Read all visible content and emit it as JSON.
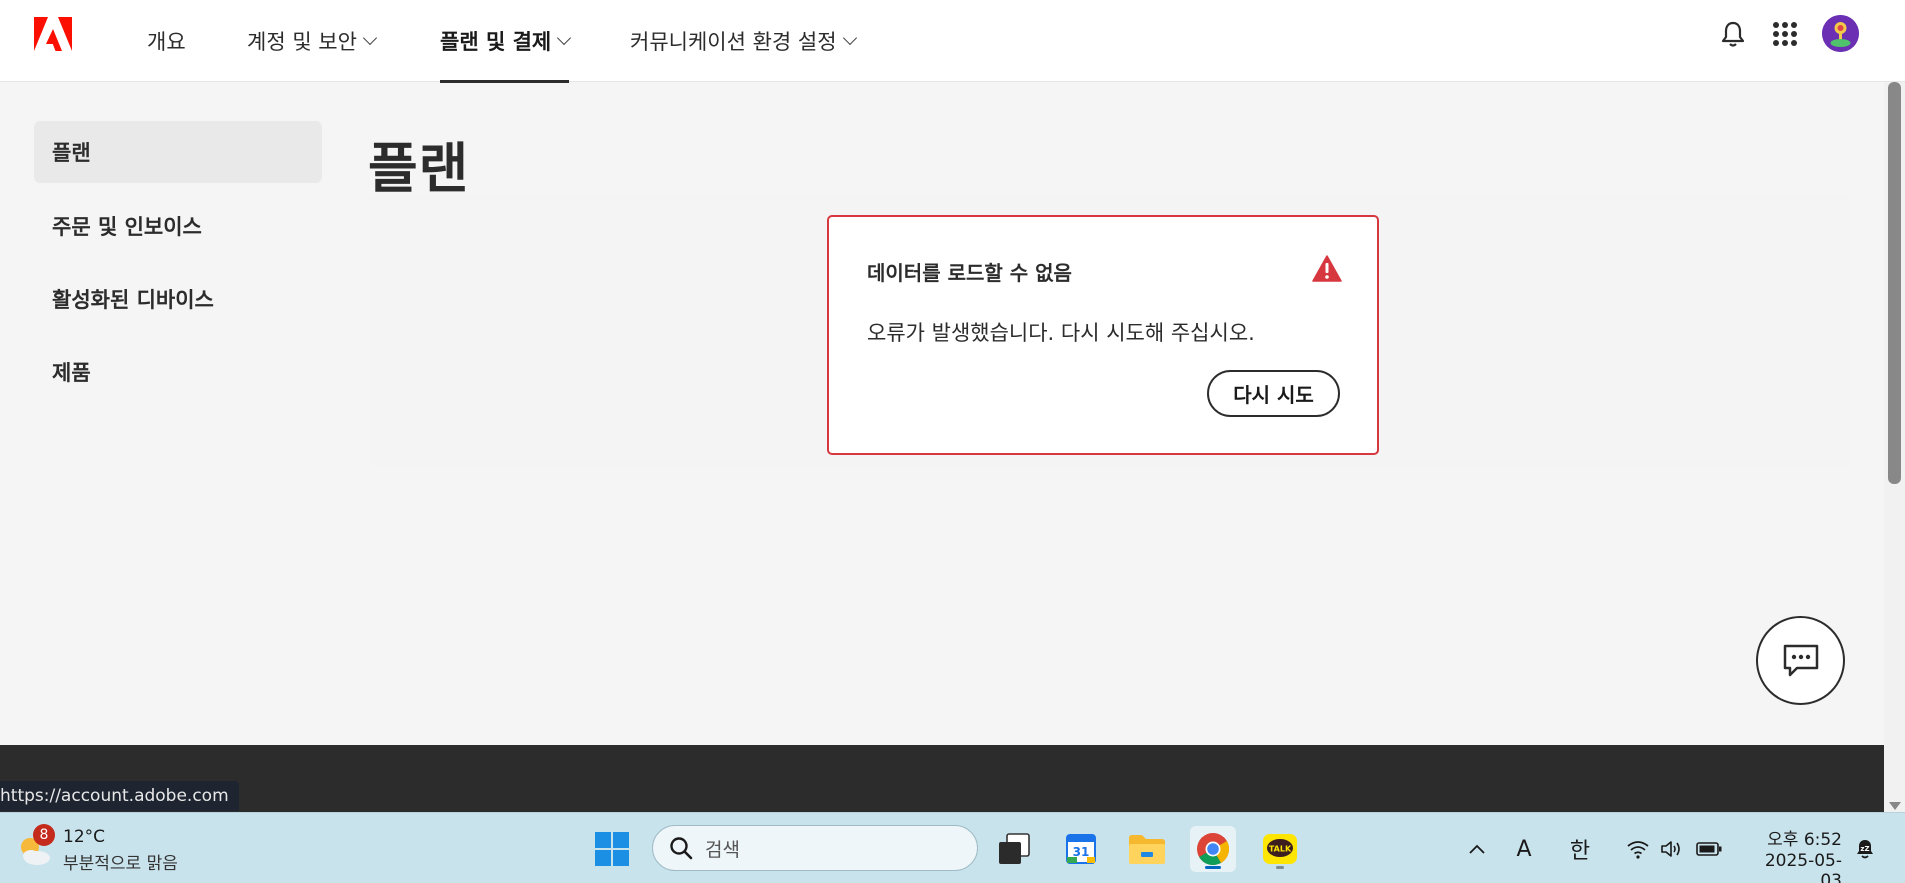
{
  "nav": {
    "items": [
      {
        "label": "개요"
      },
      {
        "label": "계정 및 보안"
      },
      {
        "label": "플랜 및 결제"
      },
      {
        "label": "커뮤니케이션 환경 설정"
      }
    ],
    "icons": [
      "adobe-logo-icon",
      "bell-icon",
      "apps-grid-icon",
      "avatar"
    ]
  },
  "sidebar": {
    "items": [
      {
        "label": "플랜"
      },
      {
        "label": "주문 및 인보이스"
      },
      {
        "label": "활성화된 디바이스"
      },
      {
        "label": "제품"
      }
    ]
  },
  "main": {
    "title": "플랜",
    "error": {
      "title": "데이터를 로드할 수 없음",
      "message": "오류가 발생했습니다. 다시 시도해 주십시오.",
      "retry_label": "다시 시도"
    }
  },
  "status_url": "https://account.adobe.com",
  "taskbar": {
    "weather": {
      "badge": "8",
      "temp": "12°C",
      "desc": "부분적으로 맑음"
    },
    "search_placeholder": "검색",
    "tray": {
      "ime_mode": "A",
      "ime_lang": "한"
    },
    "clock": {
      "time": "오후 6:52",
      "date": "2025-05-03"
    },
    "calendar_day": "31",
    "kakao_label": "TALK"
  },
  "colors": {
    "accent_red": "#d7373f",
    "adobe_red": "#fa0f00",
    "nav_text": "#2c2c2c"
  }
}
